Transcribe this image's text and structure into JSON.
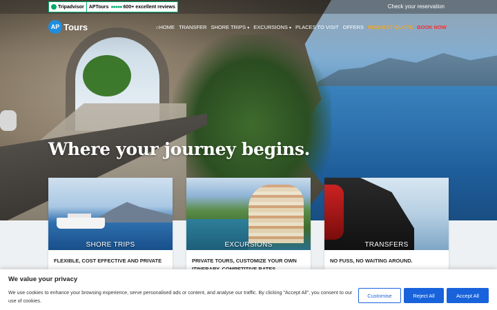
{
  "topbar": {
    "tripadvisor": {
      "brand": "Tripadvisor",
      "name": "APTours",
      "rating_dots": "●●●●●",
      "reviews": "600+ excellent reviews"
    },
    "check_reservation": "Check your reservation"
  },
  "logo": {
    "mark": "AP",
    "text": "Tours"
  },
  "nav": {
    "home": "HOME",
    "transfer": "TRANSFER",
    "shore_trips": "SHORE TRIPS",
    "excursions": "EXCURSIONS",
    "places": "PLACES TO VISIT",
    "offers": "OFFERS",
    "request_quote": "REQUEST QUOTE",
    "book_now": "BOOK NOW",
    "home_icon": "⌂",
    "caret": "▾"
  },
  "hero": {
    "headline": "Where your journey begins."
  },
  "cards": [
    {
      "label": "SHORE TRIPS",
      "desc": "FLEXIBLE, COST EFFECTIVE AND PRIVATE"
    },
    {
      "label": "EXCURSIONS",
      "desc": "PRIVATE TOURS, CUSTOMIZE YOUR OWN ITINERARY, COMPETITIVE RATES"
    },
    {
      "label": "TRANSFERS",
      "desc": "NO FUSS, NO WAITING AROUND."
    }
  ],
  "cookie": {
    "title": "We value your privacy",
    "message": "We use cookies to enhance your browsing experience, serve personalised ads or content, and analyse our traffic. By clicking \"Accept All\", you consent to our use of cookies.",
    "customise": "Customise",
    "reject": "Reject All",
    "accept": "Accept All"
  },
  "colors": {
    "accent": "#1863dc",
    "quote": "#f5a623",
    "book": "#ff2b2b",
    "tripadvisor": "#00aa6c"
  }
}
